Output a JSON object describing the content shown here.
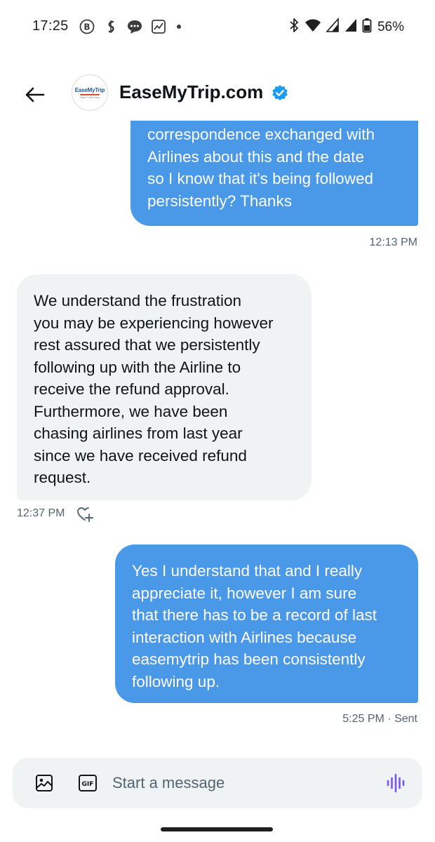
{
  "status_bar": {
    "time": "17:25",
    "battery": "56%",
    "notification_icons": [
      "b-circle-icon",
      "dollar-swirl-icon",
      "chat-bubble-icon",
      "trend-chart-icon",
      "dot-icon"
    ],
    "system_icons": [
      "bluetooth-icon",
      "wifi-icon",
      "signal-icon",
      "signal-icon",
      "battery-icon"
    ]
  },
  "header": {
    "contact_name": "EaseMyTrip.com",
    "avatar_brand": "EaseMyTrip",
    "avatar_tagline": "Make Travel Easy",
    "verified": true
  },
  "messages": [
    {
      "direction": "outgoing",
      "lines": [
        "correspondence exchanged with",
        "Airlines about this and the date",
        "so I know that it's being followed",
        "persistently? Thanks"
      ],
      "meta": "12:13 PM"
    },
    {
      "direction": "incoming",
      "lines": [
        "We understand the frustration",
        "you may be experiencing however",
        "rest assured that we persistently",
        "following up with the Airline to",
        "receive the refund approval.",
        "Furthermore, we have been",
        "chasing airlines from last year",
        "since we have received refund",
        "request."
      ],
      "meta": "12:37 PM"
    },
    {
      "direction": "outgoing",
      "lines": [
        "Yes I understand that and I really",
        "appreciate it, however I am sure",
        "that there has to be a record of last",
        "interaction with Airlines because",
        "easemytrip has been consistently",
        "following up."
      ],
      "meta": "5:25 PM · Sent"
    }
  ],
  "composer": {
    "placeholder": "Start a message",
    "gif_label": "GIF"
  },
  "colors": {
    "outgoing_bubble": "#4a99e9",
    "incoming_bubble": "#eff3f4",
    "verified_badge": "#1d9bf0",
    "voice_icon": "#7856ff",
    "meta_text": "#536471"
  }
}
